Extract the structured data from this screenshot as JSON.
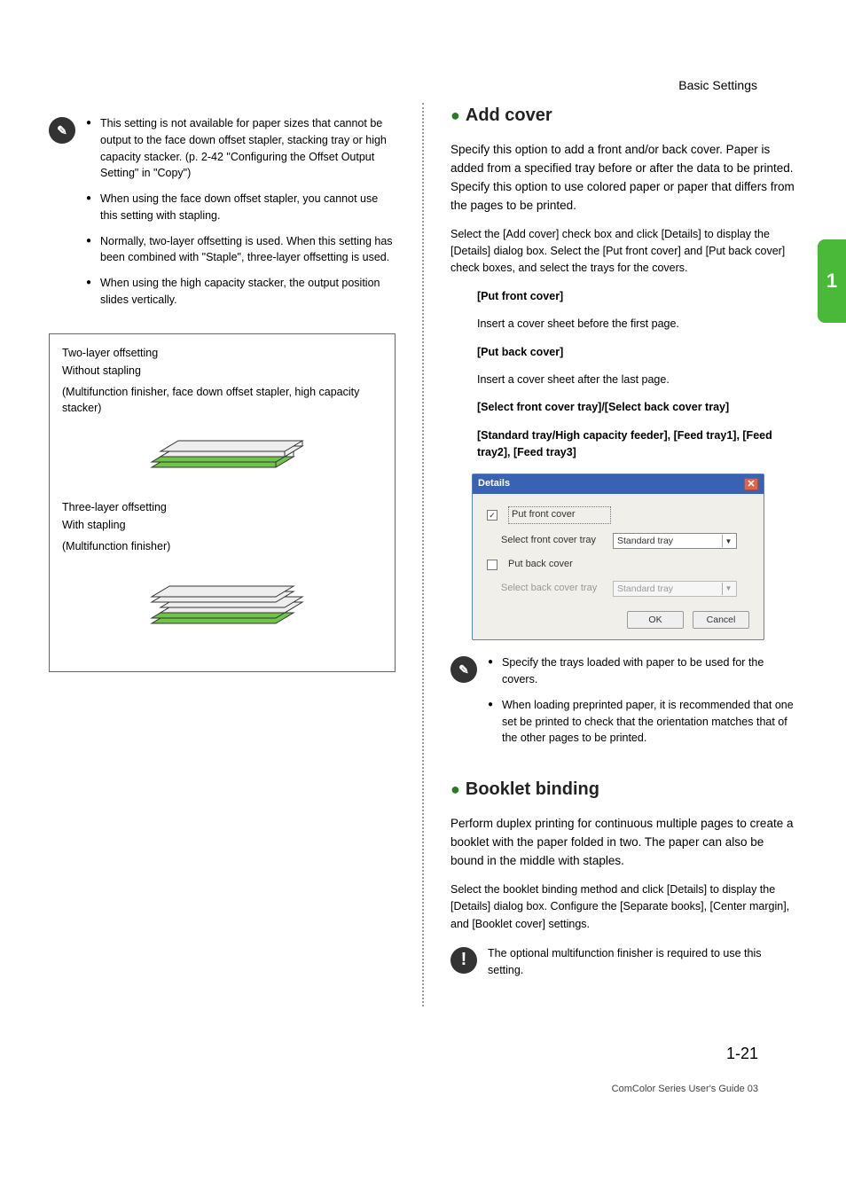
{
  "header": {
    "section": "Basic Settings",
    "tab": "1"
  },
  "left": {
    "notes": [
      "This setting is not available for paper sizes that cannot be output to the face down offset stapler, stacking tray or high capacity stacker. (p. 2-42 \"Configuring the Offset Output Setting\" in \"Copy\")",
      "When using the face down offset stapler, you cannot use this setting with stapling.",
      "Normally, two-layer offsetting is used. When this setting has been combined with \"Staple\", three-layer offsetting is used.",
      "When using the high capacity stacker, the output position slides vertically."
    ],
    "diagram": {
      "two_title": "Two-layer offsetting",
      "two_sub1": "Without stapling",
      "two_sub2": "(Multifunction finisher, face down offset stapler, high capacity stacker)",
      "three_title": "Three-layer offsetting",
      "three_sub1": "With stapling",
      "three_sub2": "(Multifunction finisher)"
    }
  },
  "right": {
    "add_cover": {
      "title": "Add cover",
      "p1": "Specify this option to add a front and/or back cover. Paper is added from a specified tray before or after the data to be printed. Specify this option to use colored paper or paper that differs from the pages to be printed.",
      "p2": "Select the [Add cover] check box and click [Details] to display the [Details] dialog box. Select the [Put front cover] and [Put back cover] check boxes, and select the trays for the covers.",
      "opt1_title": "[Put front cover]",
      "opt1_desc": "Insert a cover sheet before the first page.",
      "opt2_title": "[Put back cover]",
      "opt2_desc": "Insert a cover sheet after the last page.",
      "opt3_title": "[Select front cover tray]/[Select back cover tray]",
      "opt3_line2": "[Standard tray/High capacity feeder], [Feed tray1], [Feed tray2], [Feed tray3]",
      "notes": [
        "Specify the trays loaded with paper to be used for the covers.",
        "When loading preprinted paper, it is recommended that one set be printed to check that the orientation matches that of the other pages to be printed."
      ]
    },
    "dialog": {
      "title": "Details",
      "put_front": "Put front cover",
      "sel_front": "Select front cover tray",
      "front_val": "Standard tray",
      "put_back": "Put back cover",
      "sel_back": "Select back cover tray",
      "back_val": "Standard tray",
      "ok": "OK",
      "cancel": "Cancel"
    },
    "booklet": {
      "title": "Booklet binding",
      "p1": "Perform duplex printing for continuous multiple pages to create a booklet with the paper folded in two. The paper can also be bound in the middle with staples.",
      "p2": "Select the booklet binding method and click [Details] to display the [Details] dialog box. Configure the [Separate books], [Center margin], and [Booklet cover] settings.",
      "warn": "The optional multifunction finisher is required to use this setting."
    }
  },
  "footer": {
    "page": "1-21",
    "guide": "ComColor Series User's Guide 03"
  }
}
